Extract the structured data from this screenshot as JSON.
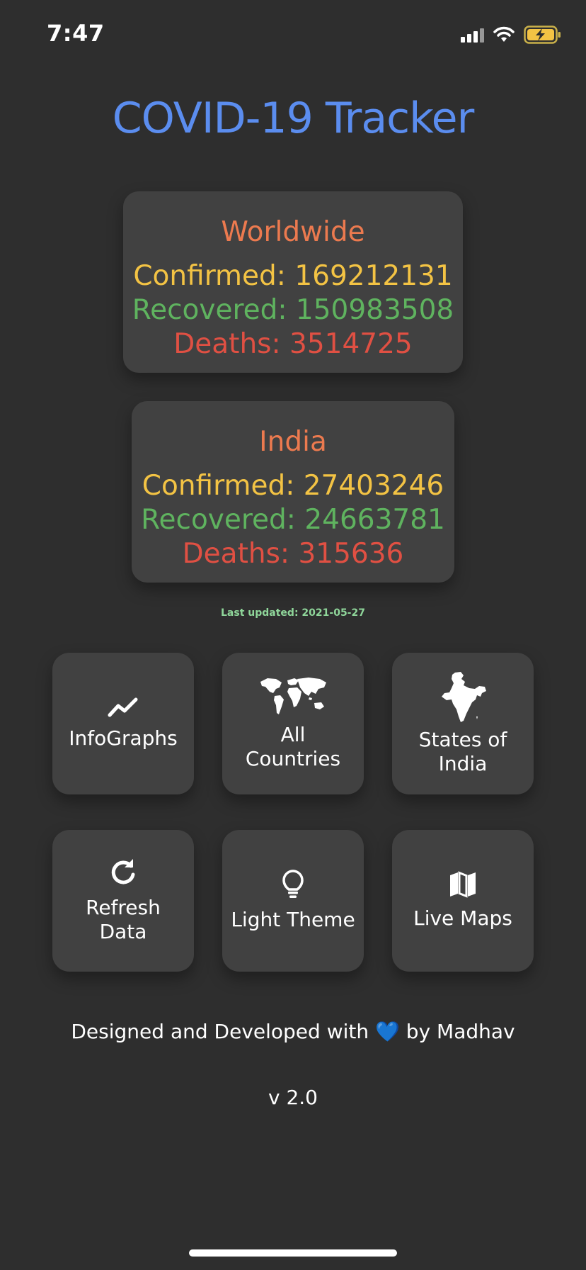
{
  "status_bar": {
    "time": "7:47"
  },
  "app": {
    "title": "COVID-19 Tracker"
  },
  "worldwide": {
    "title": "Worldwide",
    "confirmed": "Confirmed: 169212131",
    "recovered": "Recovered: 150983508",
    "deaths": "Deaths: 3514725"
  },
  "india": {
    "title": "India",
    "confirmed": "Confirmed: 27403246",
    "recovered": "Recovered: 24663781",
    "deaths": "Deaths: 315636"
  },
  "last_updated": "Last updated: 2021-05-27",
  "tiles": [
    {
      "label": "InfoGraphs",
      "icon": "trend-chart-icon"
    },
    {
      "label": "All Countries",
      "icon": "world-map-icon"
    },
    {
      "label": "States of India",
      "icon": "india-map-icon"
    },
    {
      "label": "Refresh Data",
      "icon": "refresh-icon"
    },
    {
      "label": "Light Theme",
      "icon": "lightbulb-icon"
    },
    {
      "label": "Live Maps",
      "icon": "map-icon"
    }
  ],
  "footer": {
    "prefix": "Designed and Developed with",
    "heart": "💙",
    "suffix": "by Madhav",
    "version": "v 2.0"
  },
  "colors": {
    "background": "#2e2e2e",
    "card": "#414141",
    "title": "#5b8def",
    "card_title": "#ec7a4f",
    "confirmed": "#f3c344",
    "recovered": "#5fb35f",
    "deaths": "#e05043",
    "last_updated": "#8fd69a"
  }
}
